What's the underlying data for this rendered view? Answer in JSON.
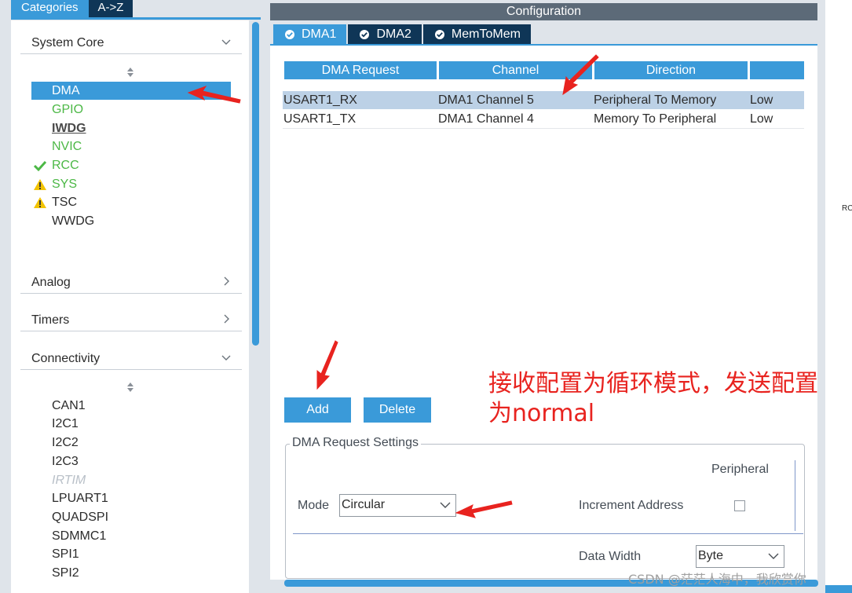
{
  "categories_panel": {
    "tabs": [
      {
        "label": "Categories",
        "active": true
      },
      {
        "label": "A->Z",
        "active": false
      }
    ],
    "sections": [
      {
        "label": "System Core",
        "expanded": true,
        "items": [
          {
            "label": "DMA",
            "state": "selected"
          },
          {
            "label": "GPIO",
            "state": "configured"
          },
          {
            "label": "IWDG",
            "state": "bold"
          },
          {
            "label": "NVIC",
            "state": "configured"
          },
          {
            "label": "RCC",
            "state": "ok"
          },
          {
            "label": "SYS",
            "state": "warning"
          },
          {
            "label": "TSC",
            "state": "warning"
          },
          {
            "label": "WWDG",
            "state": "normal"
          }
        ]
      },
      {
        "label": "Analog",
        "expanded": false
      },
      {
        "label": "Timers",
        "expanded": false
      },
      {
        "label": "Connectivity",
        "expanded": true,
        "items": [
          {
            "label": "CAN1",
            "state": "normal"
          },
          {
            "label": "I2C1",
            "state": "normal"
          },
          {
            "label": "I2C2",
            "state": "normal"
          },
          {
            "label": "I2C3",
            "state": "normal"
          },
          {
            "label": "IRTIM",
            "state": "disabled"
          },
          {
            "label": "LPUART1",
            "state": "normal"
          },
          {
            "label": "QUADSPI",
            "state": "normal"
          },
          {
            "label": "SDMMC1",
            "state": "normal"
          },
          {
            "label": "SPI1",
            "state": "normal"
          },
          {
            "label": "SPI2",
            "state": "normal"
          }
        ]
      }
    ]
  },
  "configuration": {
    "title": "Configuration",
    "tabs": [
      {
        "label": "DMA1",
        "active": true
      },
      {
        "label": "DMA2",
        "active": false
      },
      {
        "label": "MemToMem",
        "active": false
      }
    ],
    "table": {
      "columns": [
        "DMA Request",
        "Channel",
        "Direction",
        ""
      ],
      "rows": [
        {
          "request": "USART1_RX",
          "channel": "DMA1 Channel 5",
          "direction": "Peripheral To Memory",
          "priority": "Low",
          "selected": true
        },
        {
          "request": "USART1_TX",
          "channel": "DMA1 Channel 4",
          "direction": "Memory To Peripheral",
          "priority": "Low",
          "selected": false
        }
      ]
    },
    "buttons": {
      "add": "Add",
      "delete": "Delete"
    },
    "settings": {
      "legend": "DMA Request Settings",
      "mode_label": "Mode",
      "mode_value": "Circular",
      "peripheral_label": "Peripheral",
      "increment_address_label": "Increment Address",
      "increment_checked": false,
      "data_width_label": "Data Width",
      "data_width_value": "Byte"
    }
  },
  "annotation": {
    "text": "接收配置为循环模式，发送配置为normal",
    "color": "#e8231f"
  },
  "edge_text": "RC",
  "watermark": "CSDN @茫茫人海中，我欣赏你",
  "colors": {
    "accent": "#3a9ad9",
    "tab_dark": "#0f3657",
    "configured_green": "#4cb846",
    "warning_yellow": "#f2c300",
    "annotation_red": "#e8231f"
  }
}
